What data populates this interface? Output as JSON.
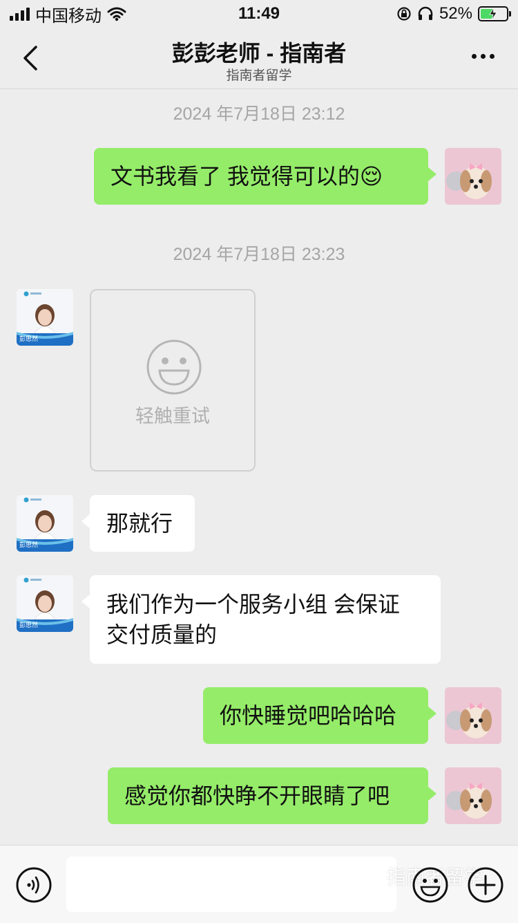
{
  "status_bar": {
    "carrier": "中国移动",
    "time": "11:49",
    "battery_percent": "52%",
    "battery_level": 0.52,
    "icons": [
      "signal-icon",
      "wifi-icon",
      "rotation-lock-icon",
      "headphones-icon",
      "battery-charging-icon"
    ]
  },
  "nav": {
    "title": "彭彭老师 - 指南者",
    "subtitle": "指南者留学"
  },
  "messages": {
    "ts1": "2024 年7月18日 23:12",
    "m1": "文书我看了 我觉得可以的😌",
    "ts2": "2024 年7月18日 23:23",
    "retry_label": "轻触重试",
    "m3": "那就行",
    "m4_line1": "我们作为一个服务小组 会保证",
    "m4_line2": "交付质量的",
    "m5": "你快睡觉吧哈哈哈",
    "m6": "感觉你都快睁不开眼睛了吧"
  },
  "avatar_other": {
    "name": "彭思然"
  },
  "bottom": {
    "watermark": "指南者留学"
  },
  "colors": {
    "self_bubble": "#95ec69",
    "other_bubble": "#ffffff",
    "background": "#ededed",
    "timestamp": "#a5a5a5"
  }
}
